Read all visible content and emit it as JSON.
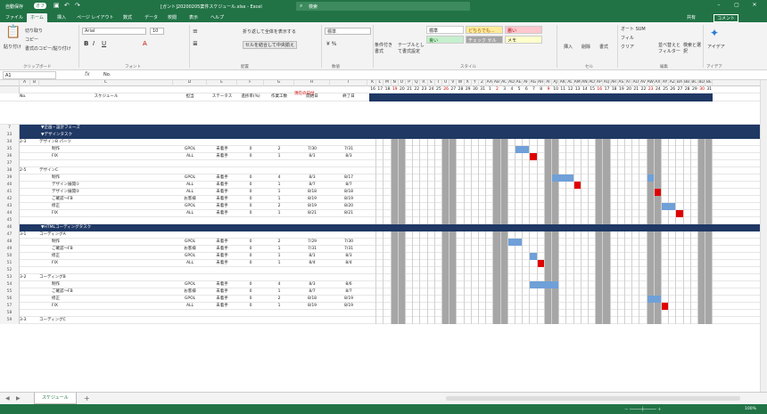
{
  "titlebar": {
    "autosave": "自動保存",
    "autosave_state": "オフ",
    "filename": "[ガント]20200205案件スケジュール.xlsx - Excel",
    "search": "検索",
    "share": "共有",
    "comment": "コメント"
  },
  "tabs": [
    "ファイル",
    "ホーム",
    "挿入",
    "ページ レイアウト",
    "数式",
    "データ",
    "校閲",
    "表示",
    "ヘルプ"
  ],
  "ribbon": {
    "clipboard": {
      "paste": "貼り付け",
      "cut": "切り取り",
      "copy": "コピー",
      "format_painter": "書式のコピー/貼り付け",
      "label": "クリップボード"
    },
    "font": {
      "name": "Arial",
      "size": "10",
      "label": "フォント"
    },
    "alignment": {
      "wrap": "折り返して全体を表示する",
      "merge": "セルを結合して中央揃え",
      "label": "配置"
    },
    "number": {
      "format": "標準",
      "label": "数値"
    },
    "styles": {
      "conditional": "条件付き書式",
      "table": "テーブルとして書式設定",
      "s1": "標準",
      "s2": "どちらでも...",
      "s3": "悪い",
      "s4": "良い",
      "s5": "チェック セル",
      "s6": "メモ",
      "label": "スタイル"
    },
    "cells": {
      "insert": "挿入",
      "delete": "削除",
      "format": "書式",
      "label": "セル"
    },
    "editing": {
      "autosum": "オート SUM",
      "fill": "フィル",
      "clear": "クリア",
      "sort": "並べ替えとフィルター",
      "find": "検索と選択",
      "label": "編集"
    },
    "ideas": {
      "label": "アイデア",
      "btn": "アイデア"
    }
  },
  "formula": {
    "name": "A1",
    "fx": "fx",
    "value": "No."
  },
  "columns": {
    "a": "A",
    "b": "B",
    "c": "C",
    "d": "D",
    "e": "E",
    "f": "F",
    "g": "G",
    "h": "H",
    "i": "I",
    "day_letters": [
      "K",
      "L",
      "M",
      "N",
      "O",
      "P",
      "Q",
      "R",
      "S",
      "T",
      "U",
      "V",
      "W",
      "X",
      "Y",
      "Z",
      "AA",
      "AB",
      "AC",
      "AD",
      "AE",
      "AF",
      "AG",
      "AH",
      "AI",
      "AJ",
      "AK",
      "AL",
      "AM",
      "AN",
      "AO",
      "AP",
      "AQ",
      "AR",
      "AS",
      "AT",
      "AU",
      "AV",
      "AW",
      "AX",
      "AY",
      "AZ",
      "BA",
      "BB",
      "BC",
      "BD",
      "BE"
    ]
  },
  "header": {
    "no": "No.",
    "schedule": "スケジュール",
    "owner": "担当",
    "status": "ステータス",
    "progress": "進捗率(%)",
    "effort": "作業工数",
    "start": "開始日",
    "end": "終了日",
    "note": "現在の日付"
  },
  "days": [
    "16",
    "17",
    "18",
    "19",
    "20",
    "21",
    "22",
    "23",
    "24",
    "25",
    "26",
    "27",
    "28",
    "29",
    "30",
    "31",
    "1",
    "2",
    "3",
    "4",
    "5",
    "6",
    "7",
    "8",
    "9",
    "10",
    "11",
    "12",
    "13",
    "14",
    "15",
    "16",
    "17",
    "18",
    "19",
    "20",
    "21",
    "22",
    "23",
    "24",
    "25",
    "26",
    "27",
    "28",
    "29",
    "30",
    "31"
  ],
  "rows": [
    {
      "n": "1",
      "cells": {}
    },
    {
      "n": "2",
      "cells": {}
    },
    {
      "n": "3",
      "cells": {}
    },
    {
      "n": "4",
      "cells": {}
    },
    {
      "n": "5",
      "cells": {}
    },
    {
      "n": "6",
      "cells": {}
    },
    {
      "n": "7",
      "section": "▼企画・設計フェーズ"
    },
    {
      "n": "33",
      "section": "▼デザインタスク"
    },
    {
      "n": "34",
      "cells": {
        "a": "2-3",
        "c": "デザインB パーツ"
      }
    },
    {
      "n": "35",
      "cells": {
        "c": "制作",
        "d": "GPOL",
        "e": "未着手",
        "f": "0",
        "g": "2",
        "h": "7/30",
        "i": "7/31"
      },
      "bars": [
        {
          "s": 20,
          "e": 22,
          "c": "blue"
        }
      ]
    },
    {
      "n": "36",
      "cells": {
        "c": "FIX",
        "d": "ALL",
        "e": "未着手",
        "f": "0",
        "g": "1",
        "h": "8/1",
        "i": "8/3"
      },
      "bars": [
        {
          "s": 22,
          "e": 23,
          "c": "red"
        }
      ]
    },
    {
      "n": "37",
      "cells": {}
    },
    {
      "n": "38",
      "cells": {
        "a": "2-5",
        "c": "デザインC"
      }
    },
    {
      "n": "39",
      "cells": {
        "c": "制作",
        "d": "GPOL",
        "e": "未着手",
        "f": "0",
        "g": "4",
        "h": "8/3",
        "i": "8/17"
      },
      "bars": [
        {
          "s": 25,
          "e": 28,
          "c": "blue"
        },
        {
          "s": 38,
          "e": 39,
          "c": "blue"
        }
      ]
    },
    {
      "n": "40",
      "cells": {
        "c": "デザイン展開①",
        "d": "ALL",
        "e": "未着手",
        "f": "0",
        "g": "1",
        "h": "8/7",
        "i": "8/7"
      },
      "bars": [
        {
          "s": 28,
          "e": 29,
          "c": "red"
        }
      ]
    },
    {
      "n": "41",
      "cells": {
        "c": "デザイン展開②",
        "d": "ALL",
        "e": "未着手",
        "f": "0",
        "g": "1",
        "h": "8/18",
        "i": "8/18"
      },
      "bars": [
        {
          "s": 39,
          "e": 40,
          "c": "red"
        }
      ]
    },
    {
      "n": "42",
      "cells": {
        "c": "ご確認〜FB",
        "d": "お客様",
        "e": "未着手",
        "f": "0",
        "g": "1",
        "h": "8/19",
        "i": "8/19"
      }
    },
    {
      "n": "43",
      "cells": {
        "c": "修正",
        "d": "GPOL",
        "e": "未着手",
        "f": "0",
        "g": "2",
        "h": "8/19",
        "i": "8/20"
      },
      "bars": [
        {
          "s": 40,
          "e": 42,
          "c": "blue"
        }
      ]
    },
    {
      "n": "44",
      "cells": {
        "c": "FIX",
        "d": "ALL",
        "e": "未着手",
        "f": "0",
        "g": "1",
        "h": "8/21",
        "i": "8/21"
      },
      "bars": [
        {
          "s": 42,
          "e": 43,
          "c": "red"
        }
      ]
    },
    {
      "n": "45",
      "cells": {}
    },
    {
      "n": "46",
      "section": "▼HTMLコーディングタスク"
    },
    {
      "n": "47",
      "cells": {
        "a": "3-1",
        "c": "コーディングA"
      }
    },
    {
      "n": "48",
      "cells": {
        "c": "制作",
        "d": "GPOL",
        "e": "未着手",
        "f": "0",
        "g": "2",
        "h": "7/29",
        "i": "7/30"
      },
      "bars": [
        {
          "s": 19,
          "e": 21,
          "c": "blue"
        }
      ]
    },
    {
      "n": "49",
      "cells": {
        "c": "ご確認〜FB",
        "d": "お客様",
        "e": "未着手",
        "f": "0",
        "g": "1",
        "h": "7/31",
        "i": "7/31"
      }
    },
    {
      "n": "50",
      "cells": {
        "c": "修正",
        "d": "GPOL",
        "e": "未着手",
        "f": "0",
        "g": "1",
        "h": "8/1",
        "i": "8/3"
      },
      "bars": [
        {
          "s": 22,
          "e": 23,
          "c": "blue"
        }
      ]
    },
    {
      "n": "51",
      "cells": {
        "c": "FIX",
        "d": "ALL",
        "e": "未着手",
        "f": "0",
        "g": "1",
        "h": "8/4",
        "i": "8/4"
      },
      "bars": [
        {
          "s": 23,
          "e": 24,
          "c": "red"
        }
      ]
    },
    {
      "n": "52",
      "cells": {}
    },
    {
      "n": "53",
      "cells": {
        "a": "3-2",
        "c": "コーディングB"
      }
    },
    {
      "n": "54",
      "cells": {
        "c": "制作",
        "d": "GPOL",
        "e": "未着手",
        "f": "0",
        "g": "4",
        "h": "8/3",
        "i": "8/6"
      },
      "bars": [
        {
          "s": 22,
          "e": 26,
          "c": "blue"
        }
      ]
    },
    {
      "n": "55",
      "cells": {
        "c": "ご確認〜FB",
        "d": "お客様",
        "e": "未着手",
        "f": "0",
        "g": "1",
        "h": "8/7",
        "i": "8/7"
      }
    },
    {
      "n": "56",
      "cells": {
        "c": "修正",
        "d": "GPOL",
        "e": "未着手",
        "f": "0",
        "g": "2",
        "h": "8/18",
        "i": "8/19"
      },
      "bars": [
        {
          "s": 38,
          "e": 40,
          "c": "blue"
        }
      ]
    },
    {
      "n": "57",
      "cells": {
        "c": "FIX",
        "d": "ALL",
        "e": "未着手",
        "f": "0",
        "g": "1",
        "h": "8/19",
        "i": "8/19"
      },
      "bars": [
        {
          "s": 40,
          "e": 41,
          "c": "red"
        }
      ]
    },
    {
      "n": "58",
      "cells": {}
    },
    {
      "n": "59",
      "cells": {
        "a": "3-3",
        "c": "コーディングC"
      }
    }
  ],
  "sheet": {
    "name": "スケジュール",
    "add": "+"
  },
  "status": {
    "zoom": "100%"
  }
}
